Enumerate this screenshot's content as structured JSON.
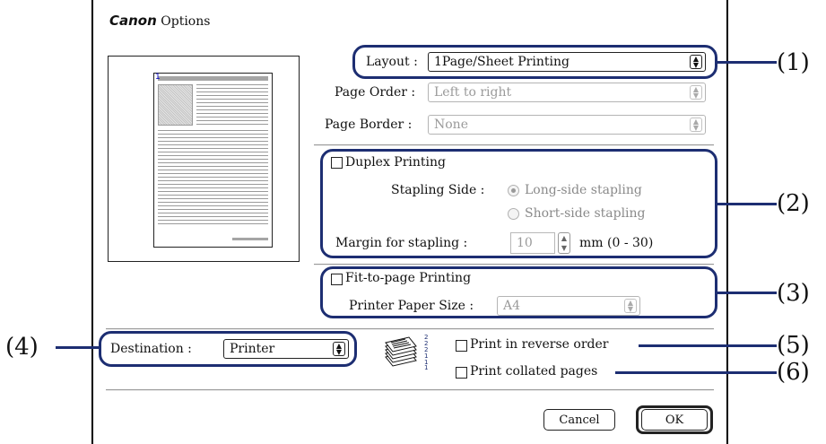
{
  "window": {
    "brand": "Canon",
    "title": "Options"
  },
  "layout": {
    "label": "Layout :",
    "value": "1Page/Sheet Printing"
  },
  "page_order": {
    "label": "Page Order :",
    "value": "Left to right"
  },
  "page_border": {
    "label": "Page Border :",
    "value": "None"
  },
  "preview": {
    "page_number": "1"
  },
  "duplex": {
    "label": "Duplex Printing",
    "checked": false,
    "stapling_side_label": "Stapling Side :",
    "options": [
      "Long-side stapling",
      "Short-side stapling"
    ],
    "selected": "Long-side stapling",
    "margin_label": "Margin for stapling :",
    "margin_value": "10",
    "margin_unit": "mm (0 - 30)"
  },
  "fit_to_page": {
    "label": "Fit-to-page Printing",
    "checked": false,
    "paper_size_label": "Printer Paper Size :",
    "paper_size_value": "A4"
  },
  "destination": {
    "label": "Destination :",
    "value": "Printer"
  },
  "reverse_order": {
    "label": "Print in reverse order",
    "checked": false
  },
  "collated": {
    "label": "Print collated pages",
    "checked": false
  },
  "buttons": {
    "cancel": "Cancel",
    "ok": "OK"
  },
  "callouts": [
    "(1)",
    "(2)",
    "(3)",
    "(4)",
    "(5)",
    "(6)"
  ],
  "colors": {
    "callout": "#1d2e72"
  }
}
